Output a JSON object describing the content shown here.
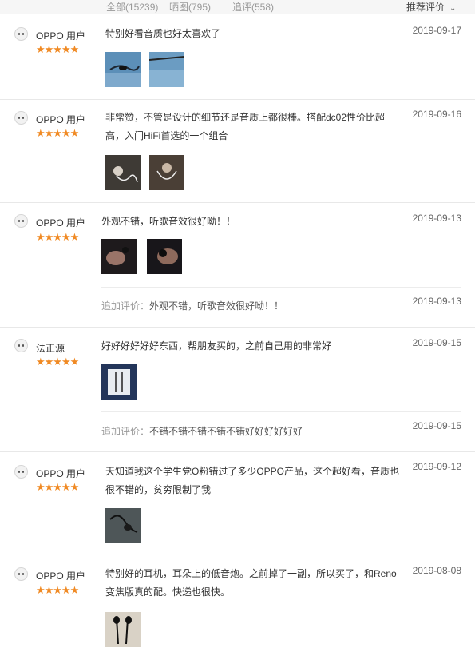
{
  "filters": {
    "all": "全部(15239)",
    "photos": "晒图(795)",
    "followups": "追评(558)",
    "sort_label": "推荐评价"
  },
  "stars": "★★★★★",
  "append_prefix": "追加评价：",
  "reviews": [
    {
      "user": "OPPO 用户",
      "text": "特别好看音质也好太喜欢了",
      "date": "2019-09-17"
    },
    {
      "user": "OPPO 用户",
      "text": "非常赞，不管是设计的细节还是音质上都很棒。搭配dc02性价比超高，入门HiFi首选的一个组合",
      "date": "2019-09-16"
    },
    {
      "user": "OPPO 用户",
      "text": "外观不错，听歌音效很好呦！！",
      "date": "2019-09-13",
      "followup_text": "外观不错，听歌音效很好呦！！",
      "followup_date": "2019-09-13"
    },
    {
      "user": "法正源",
      "text": "好好好好好好东西，帮朋友买的，之前自己用的非常好",
      "date": "2019-09-15",
      "followup_text": "不错不错不错不错不错好好好好好好",
      "followup_date": "2019-09-15"
    },
    {
      "user": "OPPO 用户",
      "text": "天知道我这个学生党O粉错过了多少OPPO产品，这个超好看，音质也很不错的，贫穷限制了我",
      "date": "2019-09-12"
    },
    {
      "user": "OPPO 用户",
      "text": "特别好的耳机，耳朵上的低音炮。之前掉了一副，所以买了，和Reno变焦版真的配。快递也很快。",
      "date": "2019-08-08"
    }
  ]
}
